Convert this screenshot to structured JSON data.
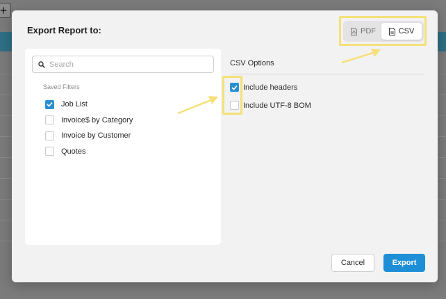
{
  "background": {
    "plus_label": "+"
  },
  "dialog": {
    "title": "Export Report to:",
    "format_toggle": {
      "pdf_label": "PDF",
      "csv_label": "CSV",
      "selected": "CSV"
    },
    "search": {
      "placeholder": "Search",
      "value": ""
    },
    "saved_filters": {
      "label": "Saved Filters",
      "items": [
        {
          "label": "Job List",
          "checked": true
        },
        {
          "label": "Invoice$ by Category",
          "checked": false
        },
        {
          "label": "Invoice by Customer",
          "checked": false
        },
        {
          "label": "Quotes",
          "checked": false
        }
      ]
    },
    "csv_options": {
      "title": "CSV Options",
      "include_headers": {
        "label": "Include headers",
        "checked": true
      },
      "include_utf8_bom": {
        "label": "Include UTF-8 BOM",
        "checked": false
      }
    },
    "footer": {
      "cancel_label": "Cancel",
      "export_label": "Export"
    }
  },
  "colors": {
    "accent": "#1e8fd6",
    "checkbox_checked": "#2a8fd1",
    "annotation": "#f5e07a"
  },
  "icons": {
    "search": "search-icon",
    "pdf": "pdf-file-icon",
    "csv": "csv-file-icon",
    "check": "check-icon"
  }
}
